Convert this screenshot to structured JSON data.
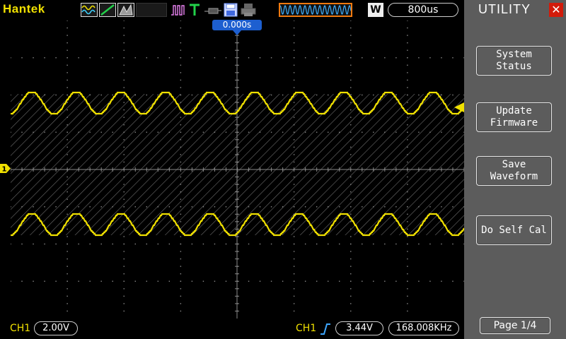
{
  "header": {
    "brand": "Hantek",
    "timebase_mode": "W",
    "timebase": "800us",
    "icons": [
      "waveform-icon",
      "ramp-icon",
      "persist-icon",
      "acquire-peak-icon",
      "trigger-T-icon",
      "probe-icon",
      "save-disk-icon",
      "printer-icon",
      "memory-waveform-icon"
    ]
  },
  "trigger": {
    "position_label": "0.000s"
  },
  "status": {
    "channel": "CH1",
    "volts_div": "2.00V",
    "trigger_channel": "CH1",
    "trigger_level": "3.44V",
    "frequency": "168.008KHz"
  },
  "menu": {
    "title": "UTILITY",
    "buttons": [
      {
        "line1": "System",
        "line2": "Status"
      },
      {
        "line1": "Update",
        "line2": "Firmware"
      },
      {
        "line1": "Save",
        "line2": "Waveform"
      },
      {
        "line1": "Do Self Cal",
        "line2": ""
      }
    ],
    "page": "Page 1/4"
  },
  "colors": {
    "trace": "#f0e000",
    "grid": "#888888",
    "menu_bg": "#5c5c5c",
    "close": "#d21b0a",
    "trigger_marker": "#1d5fd0"
  }
}
